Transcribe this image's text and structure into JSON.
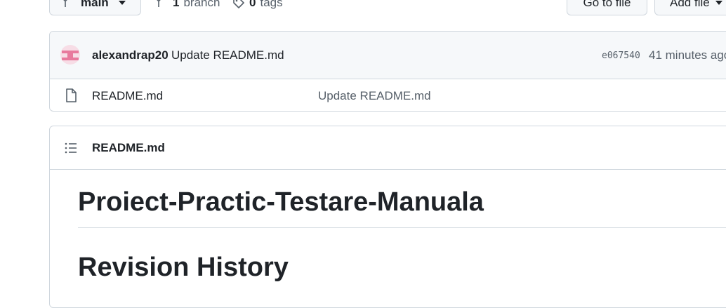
{
  "toolbar": {
    "branch_label": "main",
    "branch_count": "1",
    "branch_word": "branch",
    "tag_count": "0",
    "tag_word": "tags",
    "goto_file": "Go to file",
    "add_file": "Add file"
  },
  "commit": {
    "author": "alexandrap20",
    "message": "Update README.md",
    "sha": "e067540",
    "time": "41 minutes ago"
  },
  "files": [
    {
      "name": "README.md",
      "message": "Update README.md"
    }
  ],
  "readme": {
    "header": "README.md",
    "heading1": "Proiect-Practic-Testare-Manuala",
    "heading2": "Revision History"
  },
  "colors": {
    "accent": "#0969da",
    "avatar": "#e87a9d",
    "border": "#d0d7de"
  }
}
